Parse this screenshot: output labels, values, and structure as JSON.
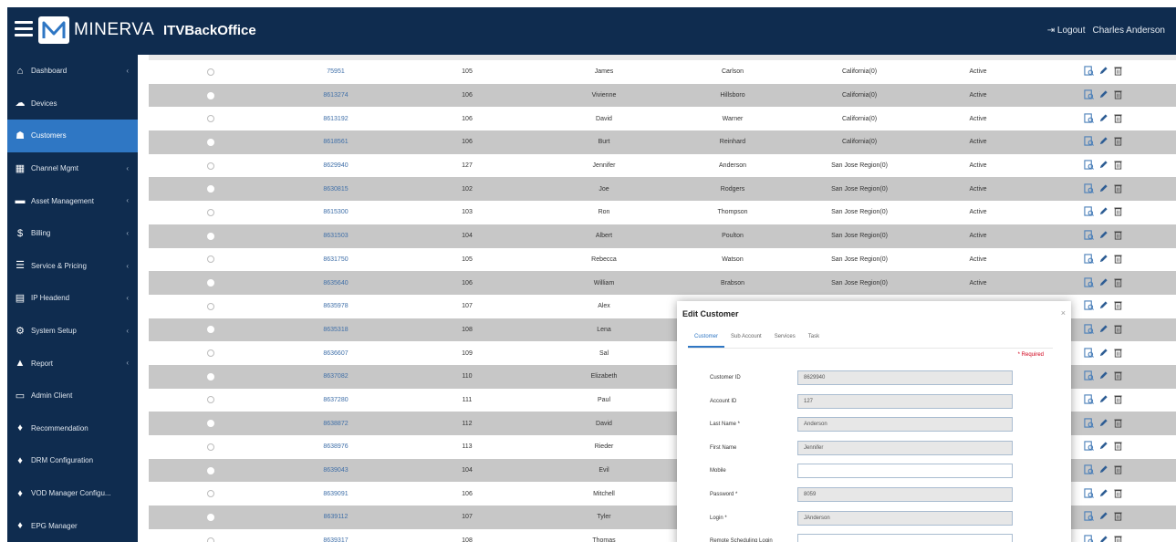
{
  "header": {
    "brand": "MINERVA",
    "app_title": "ITVBackOffice",
    "logout_label": "Logout",
    "user_name": "Charles Anderson"
  },
  "sidebar": {
    "items": [
      {
        "label": "Dashboard",
        "icon": "home-icon",
        "chevron": true
      },
      {
        "label": "Devices",
        "icon": "cloud-icon",
        "chevron": false
      },
      {
        "label": "Customers",
        "icon": "users-icon",
        "chevron": false,
        "active": true
      },
      {
        "label": "Channel Mgmt",
        "icon": "grid-icon",
        "chevron": true
      },
      {
        "label": "Asset Management",
        "icon": "folder-icon",
        "chevron": true
      },
      {
        "label": "Billing",
        "icon": "dollar-icon",
        "chevron": true
      },
      {
        "label": "Service & Pricing",
        "icon": "list-icon",
        "chevron": true
      },
      {
        "label": "IP Headend",
        "icon": "server-icon",
        "chevron": true
      },
      {
        "label": "System Setup",
        "icon": "gear-icon",
        "chevron": true
      },
      {
        "label": "Report",
        "icon": "chart-icon",
        "chevron": true
      },
      {
        "label": "Admin Client",
        "icon": "monitor-icon",
        "chevron": false
      },
      {
        "label": "Recommendation",
        "icon": "thumbs-up-icon",
        "chevron": false
      },
      {
        "label": "DRM Configuration",
        "icon": "thumbs-up-icon",
        "chevron": false
      },
      {
        "label": "VOD Manager Configu...",
        "icon": "thumbs-up-icon",
        "chevron": false
      },
      {
        "label": "EPG Manager",
        "icon": "thumbs-up-icon",
        "chevron": false
      }
    ]
  },
  "table": {
    "rows": [
      {
        "id": "75951",
        "account": "105",
        "first": "James",
        "last": "Carlson",
        "region": "California(0)",
        "status": "Active"
      },
      {
        "id": "8613274",
        "account": "106",
        "first": "Vivienne",
        "last": "Hillsboro",
        "region": "California(0)",
        "status": "Active"
      },
      {
        "id": "8613192",
        "account": "106",
        "first": "David",
        "last": "Warner",
        "region": "California(0)",
        "status": "Active"
      },
      {
        "id": "8618561",
        "account": "106",
        "first": "Burt",
        "last": "Reinhard",
        "region": "California(0)",
        "status": "Active"
      },
      {
        "id": "8629940",
        "account": "127",
        "first": "Jennifer",
        "last": "Anderson",
        "region": "San Jose Region(0)",
        "status": "Active"
      },
      {
        "id": "8630815",
        "account": "102",
        "first": "Joe",
        "last": "Rodgers",
        "region": "San Jose Region(0)",
        "status": "Active"
      },
      {
        "id": "8615300",
        "account": "103",
        "first": "Ron",
        "last": "Thompson",
        "region": "San Jose Region(0)",
        "status": "Active"
      },
      {
        "id": "8631503",
        "account": "104",
        "first": "Albert",
        "last": "Poulton",
        "region": "San Jose Region(0)",
        "status": "Active"
      },
      {
        "id": "8631750",
        "account": "105",
        "first": "Rebecca",
        "last": "Watson",
        "region": "San Jose Region(0)",
        "status": "Active"
      },
      {
        "id": "8635640",
        "account": "106",
        "first": "William",
        "last": "Brabson",
        "region": "San Jose Region(0)",
        "status": "Active"
      },
      {
        "id": "8635978",
        "account": "107",
        "first": "Alex",
        "last": "",
        "region": "",
        "status": ""
      },
      {
        "id": "8635318",
        "account": "108",
        "first": "Lena",
        "last": "",
        "region": "",
        "status": ""
      },
      {
        "id": "8636607",
        "account": "109",
        "first": "Sal",
        "last": "",
        "region": "",
        "status": ""
      },
      {
        "id": "8637082",
        "account": "110",
        "first": "Elizabeth",
        "last": "",
        "region": "",
        "status": ""
      },
      {
        "id": "8637280",
        "account": "111",
        "first": "Paul",
        "last": "",
        "region": "",
        "status": ""
      },
      {
        "id": "8638872",
        "account": "112",
        "first": "David",
        "last": "",
        "region": "",
        "status": ""
      },
      {
        "id": "8638976",
        "account": "113",
        "first": "Rieder",
        "last": "",
        "region": "",
        "status": ""
      },
      {
        "id": "8639043",
        "account": "104",
        "first": "Evil",
        "last": "",
        "region": "",
        "status": ""
      },
      {
        "id": "8639091",
        "account": "106",
        "first": "Mitchell",
        "last": "",
        "region": "",
        "status": ""
      },
      {
        "id": "8639112",
        "account": "107",
        "first": "Tyler",
        "last": "",
        "region": "",
        "status": ""
      },
      {
        "id": "8639317",
        "account": "108",
        "first": "Thomas",
        "last": "",
        "region": "",
        "status": ""
      }
    ]
  },
  "modal": {
    "title": "Edit Customer",
    "close_label": "×",
    "tabs": [
      "Customer",
      "Sub Account",
      "Services",
      "Task"
    ],
    "active_tab": 0,
    "required_note": "* Required",
    "fields": [
      {
        "label": "Customer ID",
        "value": "8629940"
      },
      {
        "label": "Account ID",
        "value": "127"
      },
      {
        "label": "Last Name *",
        "value": "Anderson"
      },
      {
        "label": "First Name",
        "value": "Jennifer"
      },
      {
        "label": "Mobile",
        "value": ""
      },
      {
        "label": "Password *",
        "value": "8059"
      },
      {
        "label": "Login *",
        "value": "JAnderson"
      },
      {
        "label": "Remote Scheduling Login",
        "value": ""
      }
    ]
  },
  "colors": {
    "navy": "#0f2c4f",
    "active_nav": "#2f77c4",
    "row_shade": "#c7c7c7",
    "link": "#3f6fa8"
  }
}
